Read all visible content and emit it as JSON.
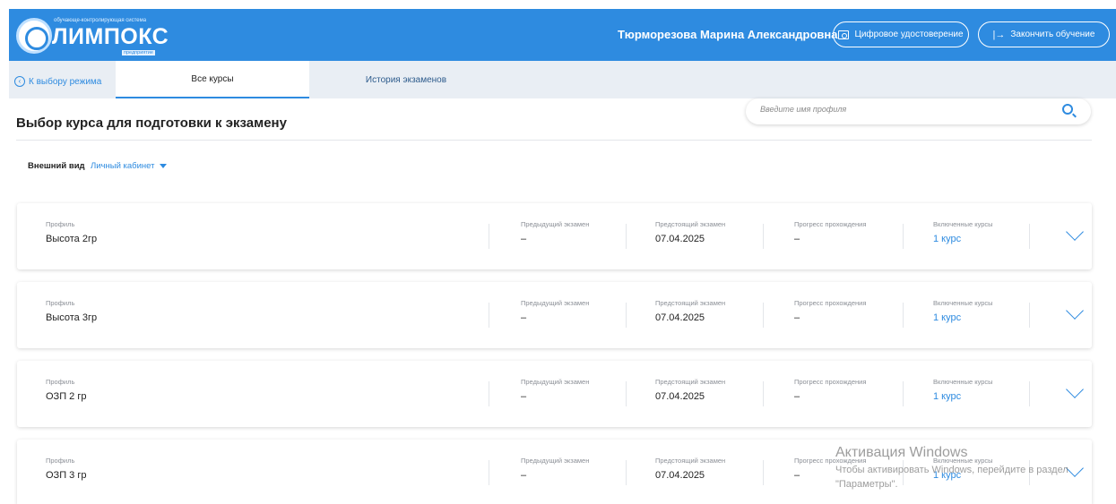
{
  "header": {
    "logo_tagline": "обучающе-контролирующая система",
    "logo_text": "ЛИМПОКС",
    "logo_sub": "предприятие",
    "user_name": "Тюрморезова Марина Александровна",
    "cert_button": "Цифровое удостоверение",
    "exit_button": "Закончить обучение",
    "brand_color": "#2e8be0"
  },
  "tabs": {
    "back": "К выбору режима",
    "all": "Все курсы",
    "history": "История экзаменов"
  },
  "main": {
    "title": "Выбор курса для подготовки к экзамену",
    "search_placeholder": "Введите имя профиля",
    "view_label": "Внешний вид",
    "view_value": "Личный кабинет"
  },
  "columns": {
    "profile": "Профиль",
    "prev_exam": "Предыдущий экзамен",
    "next_exam": "Предстоящий экзамен",
    "progress": "Прогресс прохождения",
    "courses": "Включенные курсы"
  },
  "profiles": [
    {
      "name": "Высота 2гр",
      "prev": "–",
      "next": "07.04.2025",
      "progress": "–",
      "courses": "1 курс"
    },
    {
      "name": "Высота 3гр",
      "prev": "–",
      "next": "07.04.2025",
      "progress": "–",
      "courses": "1 курс"
    },
    {
      "name": "ОЗП 2 гр",
      "prev": "–",
      "next": "07.04.2025",
      "progress": "–",
      "courses": "1 курс"
    },
    {
      "name": "ОЗП 3 гр",
      "prev": "–",
      "next": "07.04.2025",
      "progress": "–",
      "courses": "1 курс"
    }
  ],
  "watermark": {
    "title": "Активация Windows",
    "text": "Чтобы активировать Windows, перейдите в раздел \"Параметры\"."
  }
}
